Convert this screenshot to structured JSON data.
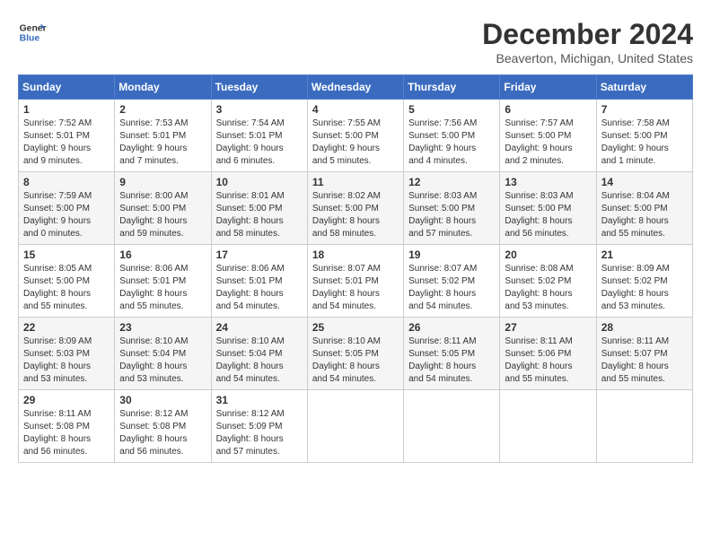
{
  "header": {
    "logo_line1": "General",
    "logo_line2": "Blue",
    "title": "December 2024",
    "subtitle": "Beaverton, Michigan, United States"
  },
  "calendar": {
    "days_of_week": [
      "Sunday",
      "Monday",
      "Tuesday",
      "Wednesday",
      "Thursday",
      "Friday",
      "Saturday"
    ],
    "weeks": [
      [
        {
          "day": "1",
          "info": "Sunrise: 7:52 AM\nSunset: 5:01 PM\nDaylight: 9 hours\nand 9 minutes."
        },
        {
          "day": "2",
          "info": "Sunrise: 7:53 AM\nSunset: 5:01 PM\nDaylight: 9 hours\nand 7 minutes."
        },
        {
          "day": "3",
          "info": "Sunrise: 7:54 AM\nSunset: 5:01 PM\nDaylight: 9 hours\nand 6 minutes."
        },
        {
          "day": "4",
          "info": "Sunrise: 7:55 AM\nSunset: 5:00 PM\nDaylight: 9 hours\nand 5 minutes."
        },
        {
          "day": "5",
          "info": "Sunrise: 7:56 AM\nSunset: 5:00 PM\nDaylight: 9 hours\nand 4 minutes."
        },
        {
          "day": "6",
          "info": "Sunrise: 7:57 AM\nSunset: 5:00 PM\nDaylight: 9 hours\nand 2 minutes."
        },
        {
          "day": "7",
          "info": "Sunrise: 7:58 AM\nSunset: 5:00 PM\nDaylight: 9 hours\nand 1 minute."
        }
      ],
      [
        {
          "day": "8",
          "info": "Sunrise: 7:59 AM\nSunset: 5:00 PM\nDaylight: 9 hours\nand 0 minutes."
        },
        {
          "day": "9",
          "info": "Sunrise: 8:00 AM\nSunset: 5:00 PM\nDaylight: 8 hours\nand 59 minutes."
        },
        {
          "day": "10",
          "info": "Sunrise: 8:01 AM\nSunset: 5:00 PM\nDaylight: 8 hours\nand 58 minutes."
        },
        {
          "day": "11",
          "info": "Sunrise: 8:02 AM\nSunset: 5:00 PM\nDaylight: 8 hours\nand 58 minutes."
        },
        {
          "day": "12",
          "info": "Sunrise: 8:03 AM\nSunset: 5:00 PM\nDaylight: 8 hours\nand 57 minutes."
        },
        {
          "day": "13",
          "info": "Sunrise: 8:03 AM\nSunset: 5:00 PM\nDaylight: 8 hours\nand 56 minutes."
        },
        {
          "day": "14",
          "info": "Sunrise: 8:04 AM\nSunset: 5:00 PM\nDaylight: 8 hours\nand 55 minutes."
        }
      ],
      [
        {
          "day": "15",
          "info": "Sunrise: 8:05 AM\nSunset: 5:00 PM\nDaylight: 8 hours\nand 55 minutes."
        },
        {
          "day": "16",
          "info": "Sunrise: 8:06 AM\nSunset: 5:01 PM\nDaylight: 8 hours\nand 55 minutes."
        },
        {
          "day": "17",
          "info": "Sunrise: 8:06 AM\nSunset: 5:01 PM\nDaylight: 8 hours\nand 54 minutes."
        },
        {
          "day": "18",
          "info": "Sunrise: 8:07 AM\nSunset: 5:01 PM\nDaylight: 8 hours\nand 54 minutes."
        },
        {
          "day": "19",
          "info": "Sunrise: 8:07 AM\nSunset: 5:02 PM\nDaylight: 8 hours\nand 54 minutes."
        },
        {
          "day": "20",
          "info": "Sunrise: 8:08 AM\nSunset: 5:02 PM\nDaylight: 8 hours\nand 53 minutes."
        },
        {
          "day": "21",
          "info": "Sunrise: 8:09 AM\nSunset: 5:02 PM\nDaylight: 8 hours\nand 53 minutes."
        }
      ],
      [
        {
          "day": "22",
          "info": "Sunrise: 8:09 AM\nSunset: 5:03 PM\nDaylight: 8 hours\nand 53 minutes."
        },
        {
          "day": "23",
          "info": "Sunrise: 8:10 AM\nSunset: 5:04 PM\nDaylight: 8 hours\nand 53 minutes."
        },
        {
          "day": "24",
          "info": "Sunrise: 8:10 AM\nSunset: 5:04 PM\nDaylight: 8 hours\nand 54 minutes."
        },
        {
          "day": "25",
          "info": "Sunrise: 8:10 AM\nSunset: 5:05 PM\nDaylight: 8 hours\nand 54 minutes."
        },
        {
          "day": "26",
          "info": "Sunrise: 8:11 AM\nSunset: 5:05 PM\nDaylight: 8 hours\nand 54 minutes."
        },
        {
          "day": "27",
          "info": "Sunrise: 8:11 AM\nSunset: 5:06 PM\nDaylight: 8 hours\nand 55 minutes."
        },
        {
          "day": "28",
          "info": "Sunrise: 8:11 AM\nSunset: 5:07 PM\nDaylight: 8 hours\nand 55 minutes."
        }
      ],
      [
        {
          "day": "29",
          "info": "Sunrise: 8:11 AM\nSunset: 5:08 PM\nDaylight: 8 hours\nand 56 minutes."
        },
        {
          "day": "30",
          "info": "Sunrise: 8:12 AM\nSunset: 5:08 PM\nDaylight: 8 hours\nand 56 minutes."
        },
        {
          "day": "31",
          "info": "Sunrise: 8:12 AM\nSunset: 5:09 PM\nDaylight: 8 hours\nand 57 minutes."
        },
        {
          "day": "",
          "info": ""
        },
        {
          "day": "",
          "info": ""
        },
        {
          "day": "",
          "info": ""
        },
        {
          "day": "",
          "info": ""
        }
      ]
    ]
  }
}
